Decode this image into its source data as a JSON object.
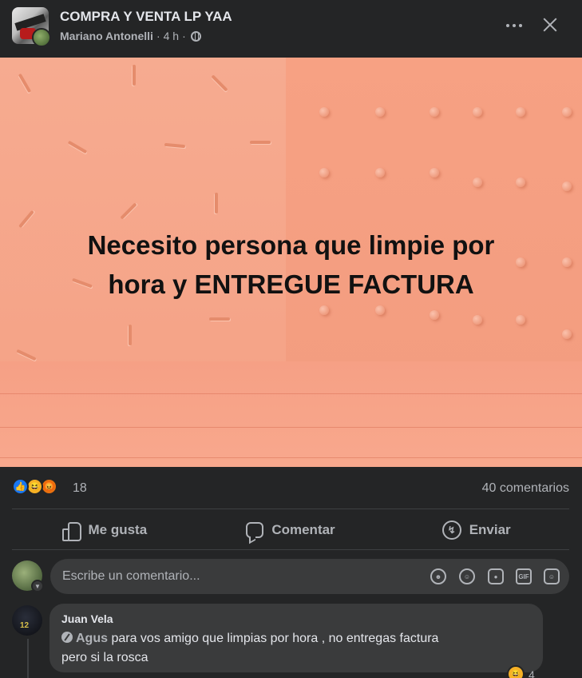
{
  "post": {
    "group_name": "COMPRA Y VENTA LP YAA",
    "author": "Mariano Antonelli",
    "time": "4 h",
    "separator": "·",
    "audience_icon": "globe-icon",
    "more_icon": "more-dots-icon",
    "close_icon": "close-icon",
    "image_text_line1": "Necesito persona que limpie por",
    "image_text_line2": "hora y ENTREGUE FACTURA",
    "image_background_color": "#f7a68a"
  },
  "stats": {
    "reaction_count": "18",
    "reaction_icons": [
      "like-reaction-icon",
      "haha-reaction-icon",
      "angry-reaction-icon"
    ],
    "comments_label": "40 comentarios"
  },
  "actions": {
    "like_label": "Me gusta",
    "comment_label": "Comentar",
    "send_label": "Enviar"
  },
  "composer": {
    "placeholder": "Escribe un comentario...",
    "icons": [
      "avatar-sticker-icon",
      "emoji-icon",
      "camera-icon",
      "gif-icon",
      "sticker-icon"
    ]
  },
  "comment": {
    "name": "Juan Vela",
    "mention": "Agus",
    "text_line1": " para vos amigo que limpias por hora , no entregas factura",
    "text_line2": "pero si la rosca",
    "reaction_count": "4"
  },
  "colors": {
    "background": "#242526",
    "bubble": "#3a3b3c",
    "text_primary": "#e4e6eb",
    "text_secondary": "#b0b3b8",
    "like_blue": "#1877f2",
    "haha_yellow": "#f7b125",
    "angry_orange": "#e9710f"
  }
}
